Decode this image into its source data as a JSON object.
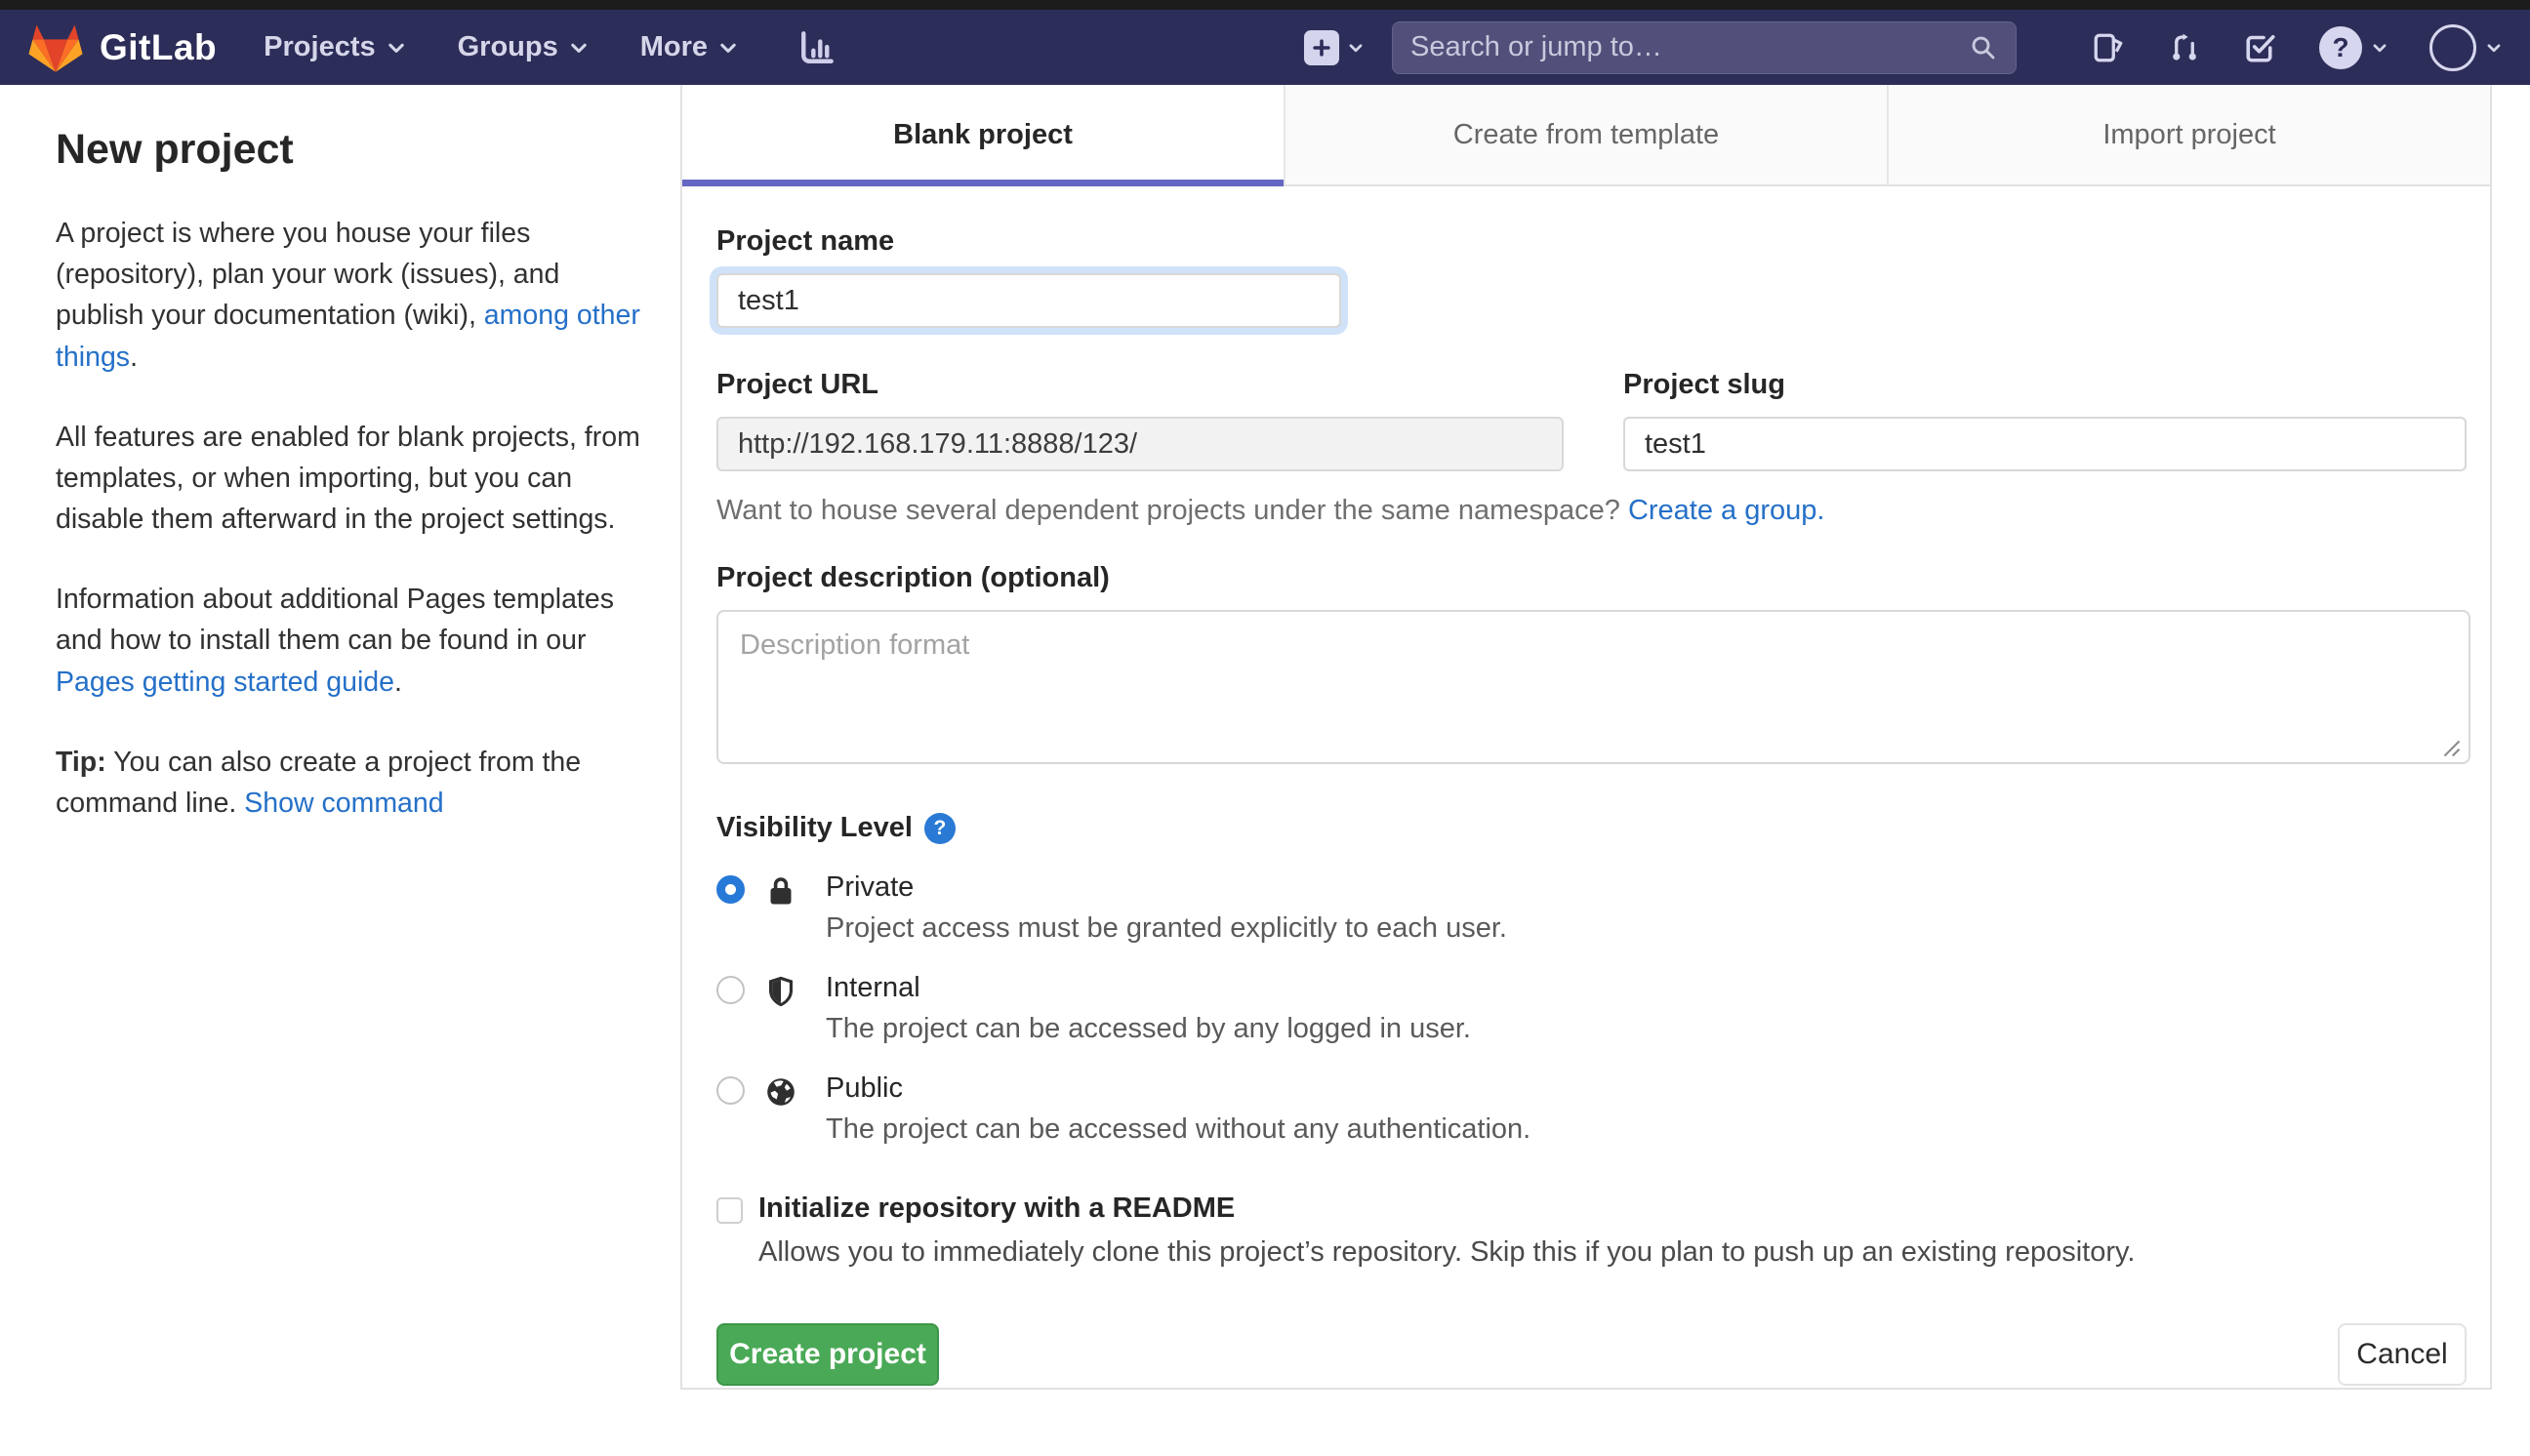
{
  "navbar": {
    "brand": "GitLab",
    "menu": [
      {
        "label": "Projects"
      },
      {
        "label": "Groups"
      },
      {
        "label": "More"
      }
    ],
    "search_placeholder": "Search or jump to…",
    "help_glyph": "?",
    "colors": {
      "bg": "#2d2d59",
      "icon": "#d6d6ef",
      "search_bg": "#50507a"
    }
  },
  "sidebar": {
    "title": "New project",
    "paragraphs": [
      {
        "segments": [
          {
            "t": "A project is where you house your files (repository), plan your work (issues), and publish your documentation (wiki), "
          },
          {
            "t": "among other things",
            "link": true
          },
          {
            "t": "."
          }
        ]
      },
      {
        "segments": [
          {
            "t": "All features are enabled for blank projects, from templates, or when importing, but you can disable them afterward in the project settings."
          }
        ]
      },
      {
        "segments": [
          {
            "t": "Information about additional Pages templates and how to install them can be found in our "
          },
          {
            "t": "Pages getting started guide",
            "link": true
          },
          {
            "t": "."
          }
        ]
      },
      {
        "segments": [
          {
            "t": "Tip:",
            "bold": true
          },
          {
            "t": " You can also create a project from the command line. "
          },
          {
            "t": "Show command",
            "link": true
          }
        ]
      }
    ]
  },
  "tabs": [
    {
      "label": "Blank project",
      "active": true
    },
    {
      "label": "Create from template",
      "active": false
    },
    {
      "label": "Import project",
      "active": false
    }
  ],
  "form": {
    "project_name": {
      "label": "Project name",
      "value": "test1"
    },
    "project_url": {
      "label": "Project URL",
      "value": "http://192.168.179.11:8888/123/"
    },
    "project_slug": {
      "label": "Project slug",
      "value": "test1"
    },
    "namespace_hint": {
      "text": "Want to house several dependent projects under the same namespace? ",
      "link": "Create a group."
    },
    "description": {
      "label": "Project description (optional)",
      "placeholder": "Description format"
    },
    "visibility": {
      "label": "Visibility Level",
      "options": [
        {
          "name": "Private",
          "desc": "Project access must be granted explicitly to each user.",
          "selected": true,
          "icon": "lock-icon"
        },
        {
          "name": "Internal",
          "desc": "The project can be accessed by any logged in user.",
          "selected": false,
          "icon": "shield-icon"
        },
        {
          "name": "Public",
          "desc": "The project can be accessed without any authentication.",
          "selected": false,
          "icon": "globe-icon"
        }
      ]
    },
    "readme": {
      "label": "Initialize repository with a README",
      "desc": "Allows you to immediately clone this project’s repository. Skip this if you plan to push up an existing repository.",
      "checked": false
    },
    "submit_label": "Create project",
    "cancel_label": "Cancel"
  },
  "colors": {
    "accent_underline": "#6666c4",
    "link": "#2570c8",
    "radio_selected": "#2779d8",
    "focus_border": "#74a8e6",
    "create_button": "#4aa956",
    "logo_red": "#e24329",
    "logo_orange": "#fc6d26",
    "logo_light_orange": "#fca326"
  }
}
